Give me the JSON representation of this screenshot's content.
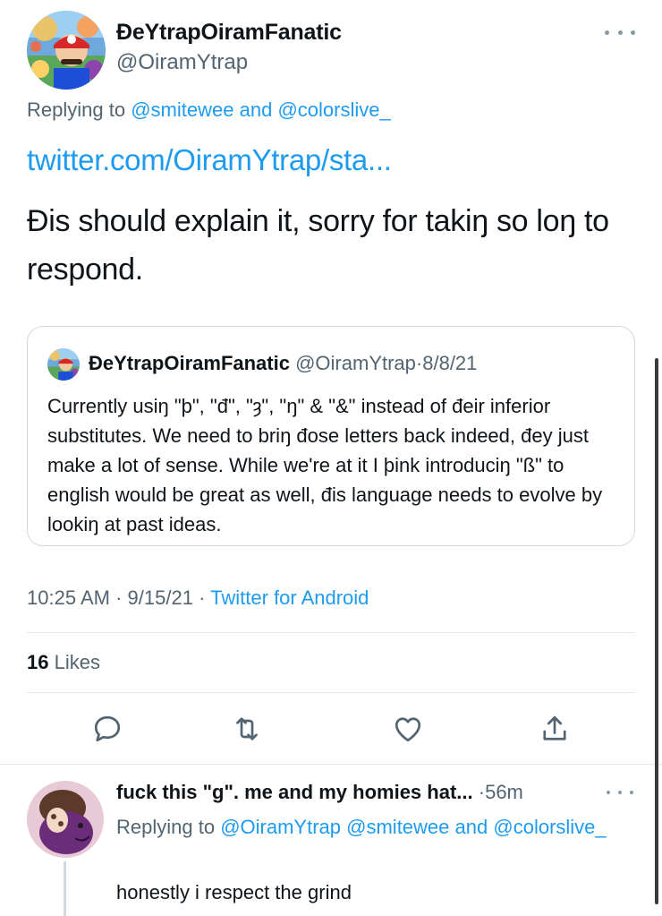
{
  "tweet": {
    "author": {
      "display_name": "ĐeYtrapOiramFanatic",
      "handle": "@OiramYtrap",
      "avatar_icon": "mario-party-avatar"
    },
    "replying_prefix": "Replying to",
    "replying_to_1": "@smitewee",
    "replying_and": "and",
    "replying_to_2": "@colorslive_",
    "link_text": "twitter.com/OiramYtrap/sta...",
    "text": "Đis should explain it, sorry for takiŋ so loŋ to respond.",
    "timestamp": "10:25 AM",
    "date": "9/15/21",
    "separator": "·",
    "source": "Twitter for Android",
    "likes_count": "16",
    "likes_label": "Likes"
  },
  "quote": {
    "display_name": "ĐeYtrapOiramFanatic",
    "handle": "@OiramYtrap",
    "separator": "·",
    "date": "8/8/21",
    "text": "Currently usiŋ \"þ\", \"đ\", \"ȝ\", \"ŋ\" & \"&\" instead of đeir inferior substitutes. We need to briŋ đose letters back indeed, đey just make a lot of sense. While we're at it I þink introduciŋ \"ß\" to english would be great as well, đis language needs to evolve by lookiŋ at past ideas."
  },
  "actions": {
    "reply_icon": "reply-icon",
    "retweet_icon": "retweet-icon",
    "like_icon": "like-icon",
    "share_icon": "share-icon"
  },
  "reply": {
    "display_name": "fuck this \"g\". me and my homies hat...",
    "separator": "·",
    "time": "56m",
    "replying_prefix": "Replying to",
    "replying_to_1": "@OiramYtrap",
    "replying_to_2": "@smitewee",
    "replying_and": "and",
    "replying_to_3": "@colorslive_",
    "text": "honestly i respect the grind"
  },
  "colors": {
    "link": "#1d9bf0",
    "secondary_text": "#536471",
    "divider": "#e1e8ed",
    "action_icon": "#536471"
  }
}
